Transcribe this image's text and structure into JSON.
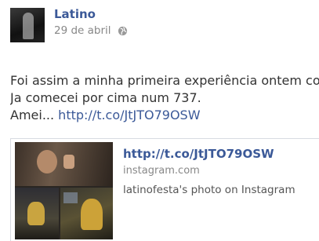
{
  "post": {
    "author": "Latino",
    "date": "29 de abril",
    "privacy_icon": "globe-icon",
    "text_lines": [
      "Foi assim a minha primeira experiência ontem co",
      "Ja comecei por cima num 737."
    ],
    "line3_prefix": "Amei... ",
    "link": "http://t.co/JtJTO79OSW"
  },
  "card": {
    "link": "http://t.co/JtJTO79OSW",
    "domain": "instagram.com",
    "description": "latinofesta's photo on Instagram"
  },
  "colors": {
    "link": "#3b5998",
    "muted": "#888888",
    "text": "#333333"
  }
}
